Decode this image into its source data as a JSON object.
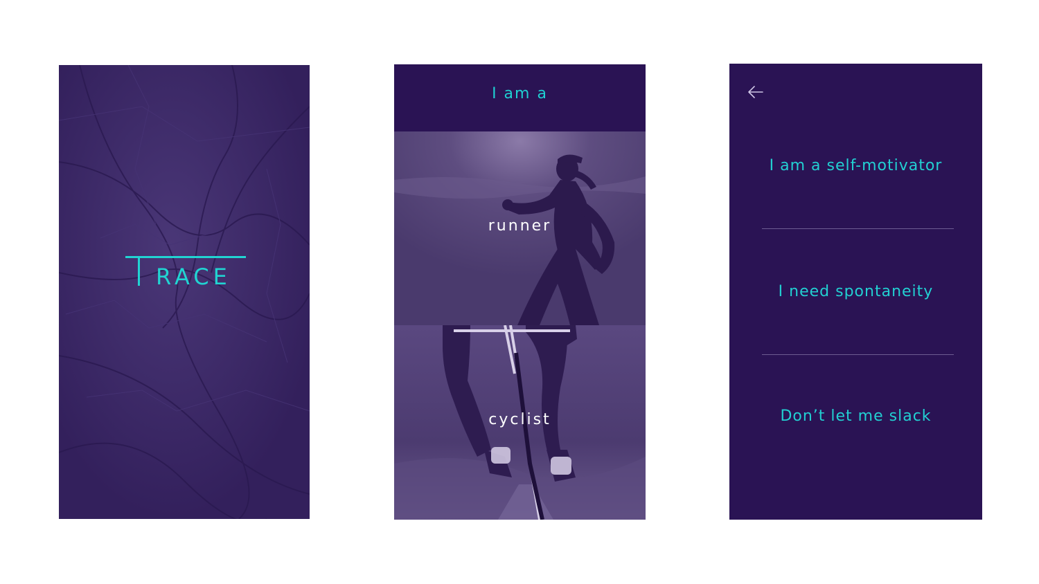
{
  "splash": {
    "logo_letter": "T",
    "logo_rest": "RACE"
  },
  "role_screen": {
    "title": "I am a",
    "options": [
      {
        "label": "runner"
      },
      {
        "label": "cyclist"
      }
    ]
  },
  "motivation_screen": {
    "back_icon": "arrow-left-icon",
    "options": [
      {
        "label": "I am a self-motivator"
      },
      {
        "label": "I need spontaneity"
      },
      {
        "label": "Don’t let me slack"
      }
    ]
  },
  "colors": {
    "accent": "#21d4d2",
    "deep_purple": "#2a1354",
    "map_purple": "#3b2764"
  }
}
